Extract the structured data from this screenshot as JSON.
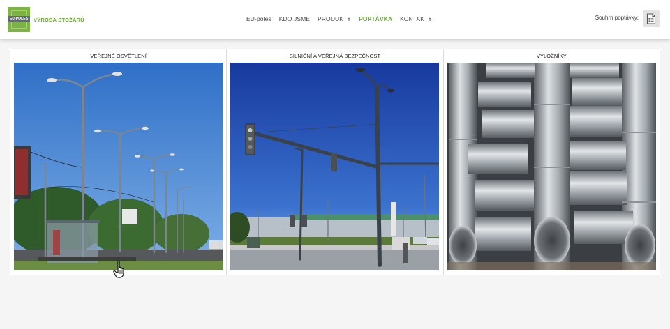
{
  "logo": {
    "mark_text": "EU-POLES",
    "name": "VÝROBA STOŽÁRŮ",
    "colors": {
      "green": "#7cb342",
      "gray": "#606a70"
    }
  },
  "nav": {
    "items": [
      {
        "label": "EU-poles",
        "active": false
      },
      {
        "label": "KDO JSME",
        "active": false
      },
      {
        "label": "PRODUKTY",
        "active": false
      },
      {
        "label": "POPTÁVKA",
        "active": true
      },
      {
        "label": "KONTAKTY",
        "active": false
      }
    ],
    "active_color": "#6aa83a"
  },
  "cart": {
    "label": "Souhrn poptávky:",
    "icon": "document-icon"
  },
  "products": [
    {
      "title": "VEŘEJNÉ OSVĚTLENÍ",
      "image": "street-lighting-photo"
    },
    {
      "title": "SILNIČNÍ A VEŘEJNÁ BEZPEČNOST",
      "image": "traffic-pole-photo"
    },
    {
      "title": "VÝLOŽNÍKY",
      "image": "galvanized-brackets-photo"
    }
  ],
  "cursor": "hand-pointer-icon"
}
